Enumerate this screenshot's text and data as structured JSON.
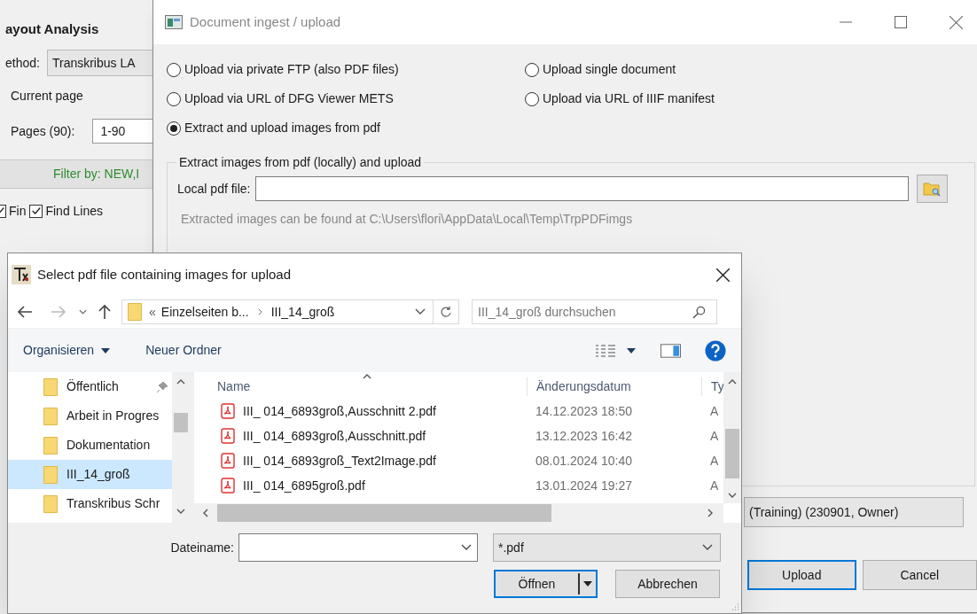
{
  "background": {
    "title": "ayout Analysis",
    "method_label": "ethod:",
    "method_value": "Transkribus LA",
    "current_page": "Current page",
    "pages_label": "Pages (90):",
    "pages_value": "1-90",
    "filter": "Filter by: NEW,I",
    "checkboxes": [
      {
        "label": "Fin",
        "checked": true
      },
      {
        "label": "Find Lines",
        "checked": true
      }
    ]
  },
  "ingest": {
    "title": "Document ingest / upload",
    "options": [
      {
        "label": "Upload via private FTP (also PDF files)",
        "selected": false
      },
      {
        "label": "Upload single document",
        "selected": false
      },
      {
        "label": "Upload via URL of DFG Viewer METS",
        "selected": false
      },
      {
        "label": "Upload via URL of IIIF manifest",
        "selected": false
      },
      {
        "label": "Extract and upload images from pdf",
        "selected": true
      }
    ],
    "group_title": "Extract images from pdf (locally) and upload",
    "field_label": "Local pdf file:",
    "hint": "Extracted images can be found at C:\\Users\\flori\\AppData\\Local\\Temp\\TrpPDFimgs",
    "collection": "(Training) (230901, Owner)",
    "buttons": [
      {
        "label": "Upload",
        "default": true
      },
      {
        "label": "Cancel",
        "default": false
      }
    ]
  },
  "file_dialog": {
    "title": "Select pdf file containing images for upload",
    "breadcrumb_prefix": "«",
    "breadcrumb": [
      "Einzelseiten b...",
      "III_14_groß"
    ],
    "search_placeholder": "III_14_groß durchsuchen",
    "organize": "Organisieren",
    "new_folder": "Neuer Ordner",
    "nav_items": [
      {
        "label": "Öffentlich",
        "selected": false,
        "pinned": true
      },
      {
        "label": "Arbeit in Progres",
        "selected": false,
        "pinned": false
      },
      {
        "label": "Dokumentation",
        "selected": false,
        "pinned": false
      },
      {
        "label": "III_14_groß",
        "selected": true,
        "pinned": false
      },
      {
        "label": "Transkribus Schr",
        "selected": false,
        "pinned": false
      }
    ],
    "columns": [
      "Name",
      "Änderungsdatum",
      "Ty"
    ],
    "rows": [
      {
        "name": "III_ 014_6893groß,Ausschnitt 2.pdf",
        "date": "14.12.2023 18:50",
        "type": "A"
      },
      {
        "name": "III_ 014_6893groß,Ausschnitt.pdf",
        "date": "13.12.2023 16:42",
        "type": "A"
      },
      {
        "name": "III_ 014_6893groß_Text2Image.pdf",
        "date": "08.01.2024 10:40",
        "type": "A"
      },
      {
        "name": "III_ 014_6895groß.pdf",
        "date": "13.01.2024 19:27",
        "type": "A"
      }
    ],
    "filename_label": "Dateiname:",
    "filter": "*.pdf",
    "buttons": [
      {
        "label": "Öffnen",
        "kind": "split",
        "default": true
      },
      {
        "label": "Abbrechen",
        "kind": "plain",
        "default": false
      }
    ]
  }
}
